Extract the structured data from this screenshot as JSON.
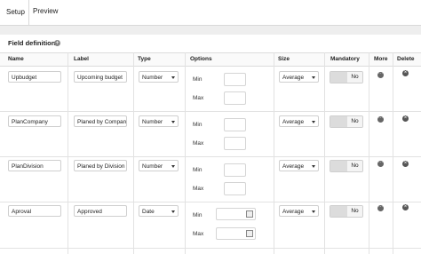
{
  "tabs": [
    {
      "label": "Setup"
    },
    {
      "label": "Preview"
    }
  ],
  "section_title": "Field definition",
  "columns": {
    "name": "Name",
    "label": "Label",
    "type": "Type",
    "options": "Options",
    "size": "Size",
    "mandatory": "Mandatory",
    "more": "More",
    "delete": "Delete"
  },
  "option_labels": {
    "min": "Min",
    "max": "Max"
  },
  "rows": [
    {
      "name": "Upbudget",
      "label": "Upcoming budget",
      "type": "Number",
      "size": "Average",
      "mandatory": "No"
    },
    {
      "name": "PlanCompany",
      "label": "Planed by Company",
      "type": "Number",
      "size": "Average",
      "mandatory": "No"
    },
    {
      "name": "PlanDivision",
      "label": "Planed by Division",
      "type": "Number",
      "size": "Average",
      "mandatory": "No"
    },
    {
      "name": "Aproval",
      "label": "Approved",
      "type": "Date",
      "size": "Average",
      "mandatory": "No"
    }
  ],
  "icons": {
    "add": "plus-circle-icon",
    "more": "ellipsis-icon",
    "delete": "close-circle-icon",
    "calendar": "calendar-icon"
  }
}
